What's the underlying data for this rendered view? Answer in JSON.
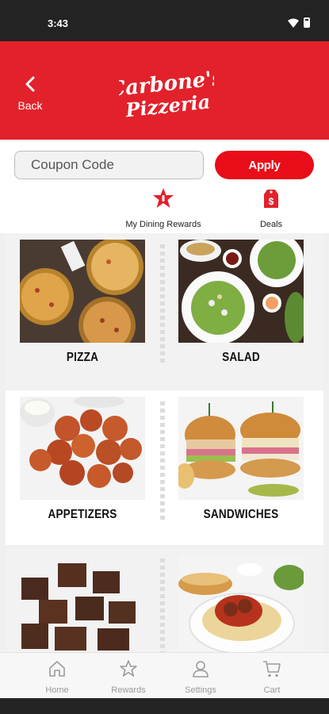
{
  "status": {
    "time": "3:43"
  },
  "header": {
    "back_label": "Back",
    "logo": {
      "line1": "Carbone's",
      "line2": "Pizzeria"
    }
  },
  "coupon": {
    "placeholder": "Coupon Code",
    "apply_label": "Apply"
  },
  "quick_links": [
    {
      "label": "My Dining Rewards",
      "icon": "rewards-star-icon"
    },
    {
      "label": "Deals",
      "icon": "deals-dollar-tag-icon"
    }
  ],
  "menu": {
    "categories": [
      {
        "label": "PIZZA",
        "image": "pizza-photo"
      },
      {
        "label": "SALAD",
        "image": "salad-photo"
      },
      {
        "label": "APPETIZERS",
        "image": "appetizers-photo"
      },
      {
        "label": "SANDWICHES",
        "image": "sandwiches-photo"
      },
      {
        "label": "",
        "image": "brownies-photo"
      },
      {
        "label": "",
        "image": "spaghetti-photo"
      }
    ]
  },
  "bottom_nav": [
    {
      "label": "Home",
      "icon": "home-icon"
    },
    {
      "label": "Rewards",
      "icon": "star-icon"
    },
    {
      "label": "Settings",
      "icon": "person-icon"
    },
    {
      "label": "Cart",
      "icon": "cart-icon"
    }
  ],
  "colors": {
    "brand_red": "#e2212b",
    "button_red": "#e80d19",
    "nav_gray": "#9a9a9a"
  }
}
